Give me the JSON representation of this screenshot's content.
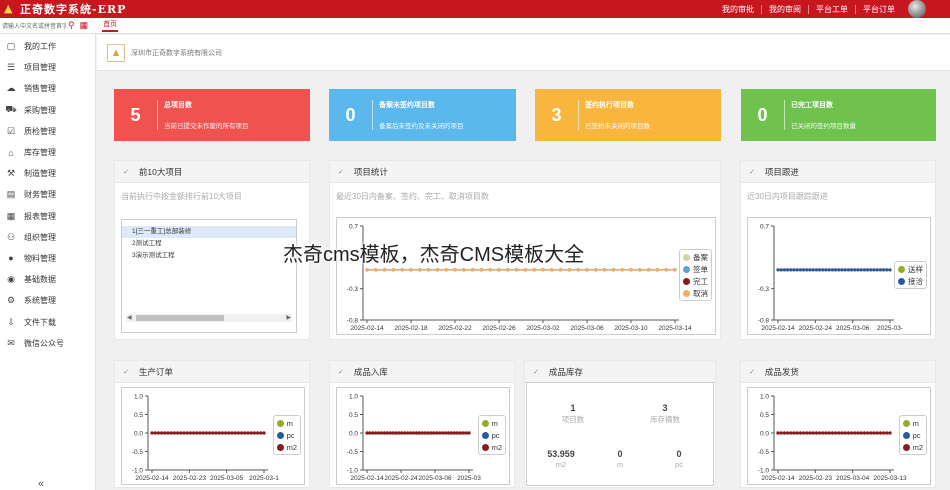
{
  "header": {
    "app_title": "正奇数字系统-ERP",
    "nav": [
      "我的审批",
      "我的审阅",
      "平台工单",
      "平台订单"
    ]
  },
  "subbar": {
    "search_placeholder": "请输入中文名或拼音首字母",
    "home_tab": "首页"
  },
  "sidebar": {
    "items": [
      {
        "label": "我的工作",
        "icon": "briefcase-icon"
      },
      {
        "label": "项目管理",
        "icon": "list-icon"
      },
      {
        "label": "销售管理",
        "icon": "cloud-icon"
      },
      {
        "label": "采购管理",
        "icon": "cart-icon"
      },
      {
        "label": "质检管理",
        "icon": "clipboard-check-icon"
      },
      {
        "label": "库存管理",
        "icon": "warehouse-icon"
      },
      {
        "label": "制造管理",
        "icon": "tools-icon"
      },
      {
        "label": "财务管理",
        "icon": "wallet-icon"
      },
      {
        "label": "报表管理",
        "icon": "table-icon"
      },
      {
        "label": "组织管理",
        "icon": "org-chart-icon"
      },
      {
        "label": "物料管理",
        "icon": "material-icon"
      },
      {
        "label": "基础数据",
        "icon": "database-icon"
      },
      {
        "label": "系统管理",
        "icon": "gear-icon"
      },
      {
        "label": "文件下载",
        "icon": "download-icon"
      },
      {
        "label": "微信公众号",
        "icon": "wechat-icon"
      }
    ],
    "collapse_glyph": "«"
  },
  "breadcrumb": {
    "company": "深圳市正奇数字系统有限公司"
  },
  "stats": [
    {
      "value": "5",
      "title": "总项目数",
      "desc": "当前已提交未作废的所有项目",
      "color": "#f0524f"
    },
    {
      "value": "0",
      "title": "备案未签约项目数",
      "desc": "备案后未签约及未关闭的项目",
      "color": "#5bb8ec"
    },
    {
      "value": "3",
      "title": "签约执行项目数",
      "desc": "已签约未关闭的项目数",
      "color": "#f8b63e"
    },
    {
      "value": "0",
      "title": "已完工项目数",
      "desc": "已关闭的签约项目数量",
      "color": "#6ec24d"
    }
  ],
  "panels": {
    "top10": {
      "title": "前10大项目",
      "subtitle": "当前执行中按金额排行前10大项目",
      "rows": [
        "1[三一重工]总部装修",
        "2测试工程",
        "3演示测试工程"
      ]
    },
    "project_stats": {
      "title": "项目统计",
      "subtitle": "最近30日内备案、签约、完工、取消项目数"
    },
    "follow": {
      "title": "项目跟进",
      "subtitle": "近30日内项目跟踪跟进"
    },
    "production": {
      "title": "生产订单"
    },
    "inbound": {
      "title": "成品入库"
    },
    "inventory": {
      "title": "成品库存",
      "cells": [
        {
          "value": "1",
          "label": "项目数"
        },
        {
          "value": "3",
          "label": "库存摘数"
        },
        {
          "value": "53.959",
          "label": "m2"
        },
        {
          "value": "0",
          "label": "m"
        },
        {
          "value": "0",
          "label": "pc"
        }
      ]
    },
    "shipping": {
      "title": "成品发货"
    }
  },
  "chart_data": [
    {
      "id": "project_stats",
      "type": "line",
      "x": [
        "2025-02-14",
        "2025-02-18",
        "2025-02-22",
        "2025-02-26",
        "2025-03-02",
        "2025-03-06",
        "2025-03-10",
        "2025-03-14"
      ],
      "yticks": [
        "0.7",
        "-0.3",
        "-0.8"
      ],
      "ylim": [
        -0.8,
        0.7
      ],
      "series": [
        {
          "name": "备案",
          "color": "#c8d9a0",
          "value": 0
        },
        {
          "name": "签单",
          "color": "#5aa2d8",
          "value": 0
        },
        {
          "name": "完工",
          "color": "#8b1a1a",
          "value": 0
        },
        {
          "name": "取消",
          "color": "#f0b060",
          "value": 0
        }
      ]
    },
    {
      "id": "follow",
      "type": "line",
      "x": [
        "2025-02-14",
        "2025-02-24",
        "2025-03-06",
        "2025-03-"
      ],
      "yticks": [
        "0.7",
        "-0.3",
        "-0.8"
      ],
      "ylim": [
        -0.8,
        0.7
      ],
      "series": [
        {
          "name": "送样",
          "color": "#9aa82a",
          "value": 0
        },
        {
          "name": "接洽",
          "color": "#2b5a9a",
          "value": 0
        }
      ]
    },
    {
      "id": "production",
      "type": "line",
      "x": [
        "2025-02-14",
        "2025-02-23",
        "2025-03-05",
        "2025-03-1"
      ],
      "yticks": [
        "1.0",
        "0.5",
        "0.0",
        "-0.5",
        "-1.0"
      ],
      "ylim": [
        -1,
        1
      ],
      "series": [
        {
          "name": "m",
          "color": "#9aa82a",
          "value": 0
        },
        {
          "name": "pc",
          "color": "#2b5a9a",
          "value": 0
        },
        {
          "name": "m2",
          "color": "#8b1a1a",
          "value": 0
        }
      ]
    },
    {
      "id": "inbound",
      "type": "line",
      "x": [
        "2025-02-14",
        "2025-02-24",
        "2025-03-06",
        "2025-03"
      ],
      "yticks": [
        "1.0",
        "0.5",
        "0.0",
        "-0.5",
        "-1.0"
      ],
      "ylim": [
        -1,
        1
      ],
      "series": [
        {
          "name": "m",
          "color": "#9aa82a",
          "value": 0
        },
        {
          "name": "pc",
          "color": "#2b5a9a",
          "value": 0
        },
        {
          "name": "m2",
          "color": "#8b1a1a",
          "value": 0
        }
      ]
    },
    {
      "id": "shipping",
      "type": "line",
      "x": [
        "2025-02-14",
        "2025-02-23",
        "2025-03-04",
        "2025-03-13"
      ],
      "yticks": [
        "1.0",
        "0.5",
        "0.0",
        "-0.5",
        "-1.0"
      ],
      "ylim": [
        -1,
        1
      ],
      "series": [
        {
          "name": "m",
          "color": "#9aa82a",
          "value": 0
        },
        {
          "name": "pc",
          "color": "#2b5a9a",
          "value": 0
        },
        {
          "name": "m2",
          "color": "#8b1a1a",
          "value": 0
        }
      ]
    }
  ],
  "watermark": "杰奇cms模板，杰奇CMS模板大全"
}
